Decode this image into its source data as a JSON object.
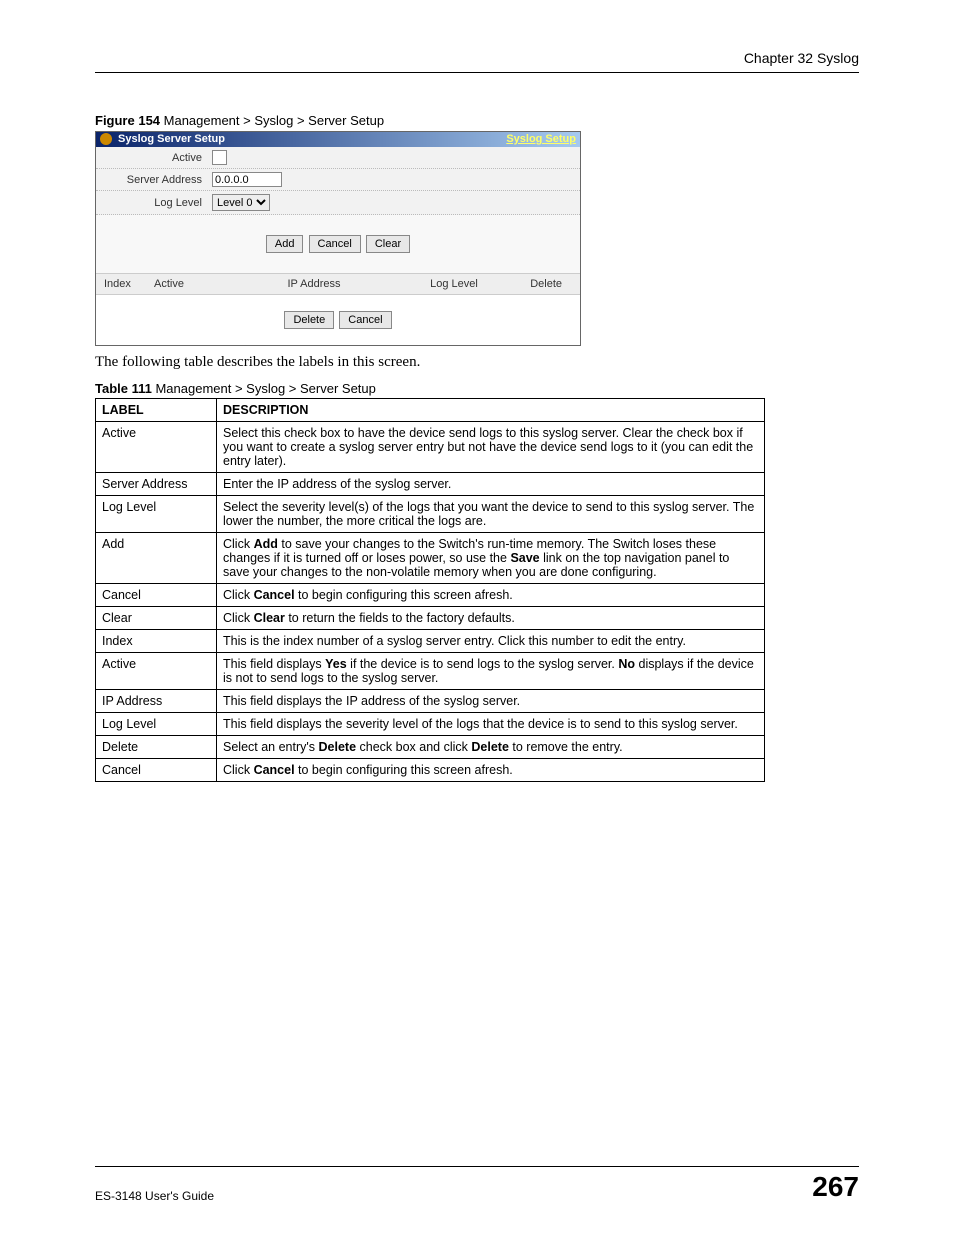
{
  "chapter_header": "Chapter 32 Syslog",
  "figure_caption_bold": "Figure 154   ",
  "figure_caption_text": "Management > Syslog > Server Setup",
  "screenshot": {
    "title": "Syslog Server Setup",
    "link": "Syslog Setup",
    "rows": {
      "active_label": "Active",
      "server_address_label": "Server Address",
      "server_address_value": "0.0.0.0",
      "log_level_label": "Log Level",
      "log_level_value": "Level 0"
    },
    "buttons": {
      "add": "Add",
      "cancel": "Cancel",
      "clear": "Clear"
    },
    "table_headers": {
      "index": "Index",
      "active": "Active",
      "ip": "IP Address",
      "log": "Log Level",
      "del": "Delete"
    },
    "bottom_buttons": {
      "delete": "Delete",
      "cancel": "Cancel"
    }
  },
  "body_text": "The following table describes the labels in this screen.",
  "table_caption_bold": "Table 111   ",
  "table_caption_text": "Management > Syslog > Server Setup",
  "table_headers": {
    "label": "LABEL",
    "description": "DESCRIPTION"
  },
  "table_rows": [
    {
      "label": "Active",
      "desc": "Select this check box to have the device send logs to this syslog server. Clear the check box if you want to create a syslog server entry but not have the device send logs to it (you can edit the entry later)."
    },
    {
      "label": "Server Address",
      "desc": "Enter the IP address of the syslog server."
    },
    {
      "label": "Log Level",
      "desc": "Select the severity level(s) of the logs that you want the device to send to this syslog server. The lower the number, the more critical the logs are."
    },
    {
      "label": "Add",
      "desc": "Click <b>Add</b> to save your changes to the Switch's run-time memory. The Switch loses these changes if it is turned off or loses power, so use the <b>Save</b> link on the top navigation panel to save your changes to the non-volatile memory when you are done configuring."
    },
    {
      "label": "Cancel",
      "desc": "Click <b>Cancel</b> to begin configuring this screen afresh."
    },
    {
      "label": "Clear",
      "desc": "Click <b>Clear</b> to return the fields to the factory defaults."
    },
    {
      "label": "Index",
      "desc": "This is the index number of a syslog server entry. Click this number to edit the entry."
    },
    {
      "label": "Active",
      "desc": "This field displays <b>Yes</b> if the device is to send logs to the syslog server. <b>No</b> displays if the device is not to send logs to the syslog server."
    },
    {
      "label": "IP Address",
      "desc": "This field displays the IP address of the syslog server."
    },
    {
      "label": "Log Level",
      "desc": "This field displays the severity level of the logs that the device is to send to this syslog server."
    },
    {
      "label": "Delete",
      "desc": "Select an entry's <b>Delete</b> check box and click <b>Delete</b> to remove the entry."
    },
    {
      "label": "Cancel",
      "desc": "Click <b>Cancel</b> to begin configuring this screen afresh."
    }
  ],
  "footer": {
    "left": "ES-3148 User's Guide",
    "right": "267"
  }
}
